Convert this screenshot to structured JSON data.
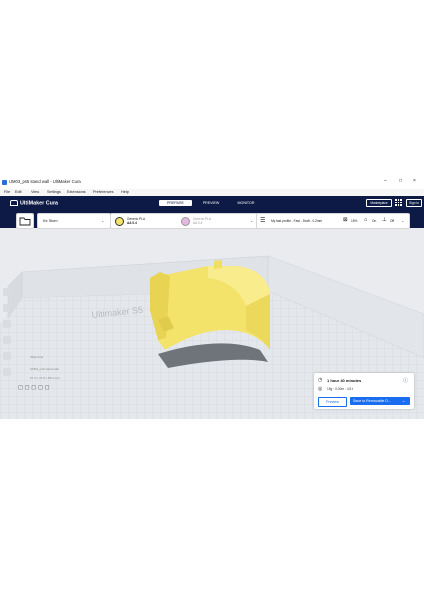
{
  "window": {
    "title": "UM03_ps5 stand wall - UltiMaker Cura"
  },
  "menu": [
    "File",
    "Edit",
    "View",
    "Settings",
    "Extensions",
    "Preferences",
    "Help"
  ],
  "header": {
    "app_name": "UltiMaker Cura",
    "tabs": [
      {
        "label": "PREPARE",
        "active": true
      },
      {
        "label": "PREVIEW",
        "active": false
      },
      {
        "label": "MONITOR",
        "active": false
      }
    ],
    "marketplace_label": "Marketplace",
    "signin_label": "Sign in"
  },
  "toolbar": {
    "printer_name": "Ke Stom",
    "extruder1": {
      "material": "Generic PLA",
      "core": "AA 0.4"
    },
    "extruder2": {
      "material": "Generic PLA",
      "core": "AA 0.4"
    },
    "profile": "My fast profile - Fast - Draft - 0.2mm",
    "infill": "15%",
    "support": "On",
    "adhesion": "Off"
  },
  "viewport": {
    "build_plate_brand": "Ultimaker S5",
    "object_info": [
      "Object list",
      "UM03_ps5 stand wall",
      "57.3 x 70.9 x 55.1 mm"
    ]
  },
  "print_panel": {
    "time": "1 hour 40 minutes",
    "material": "15g · 0.00m · 4.5 t",
    "preview_label": "Preview",
    "save_label": "Save to Removable D..."
  },
  "colors": {
    "header_bg": "#0d1a45",
    "accent_blue": "#196ef0",
    "model_yellow": "#f4e36a",
    "viewport_bg": "#e9ebee"
  }
}
